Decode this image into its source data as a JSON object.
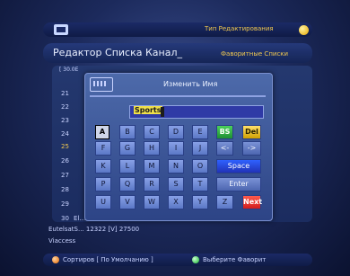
{
  "top": {
    "edit_type_label": "Тип Редактирования"
  },
  "header": {
    "title": "Редактор Списка Канал_",
    "favorites_label": "Фаворитные Списки"
  },
  "channel_list": {
    "first_row": "[ 30.0E",
    "numbers": [
      "21",
      "22",
      "23",
      "24",
      "25",
      "26",
      "27",
      "28",
      "29",
      "30"
    ],
    "highlighted": "25",
    "row30_text": "El..."
  },
  "dialog": {
    "title": "Изменить Имя",
    "name_value": "Sports"
  },
  "keyboard": {
    "row1": [
      "A",
      "B",
      "C",
      "D",
      "E",
      "BS",
      "Del"
    ],
    "row2": [
      "F",
      "G",
      "H",
      "I",
      "J",
      "<-",
      "->"
    ],
    "row3": [
      "K",
      "L",
      "M",
      "N",
      "O",
      "Space"
    ],
    "row4": [
      "P",
      "Q",
      "R",
      "S",
      "T",
      "Enter"
    ],
    "row5": [
      "U",
      "V",
      "W",
      "X",
      "Y",
      "Z",
      "Next"
    ]
  },
  "info": {
    "line1": "EutelsatS...   12322 [V] 27500",
    "line2": "Viaccess"
  },
  "footer": {
    "sort_label": "Сортиров [ По Умолчанию ]",
    "choose_fav_label": "Выберите Фаворит"
  },
  "colors": {
    "accent_yellow": "#f0c850",
    "key_green": "#1e8f33",
    "key_yellow": "#d0a000",
    "key_blue": "#2132b7",
    "key_red": "#d21e1e"
  }
}
